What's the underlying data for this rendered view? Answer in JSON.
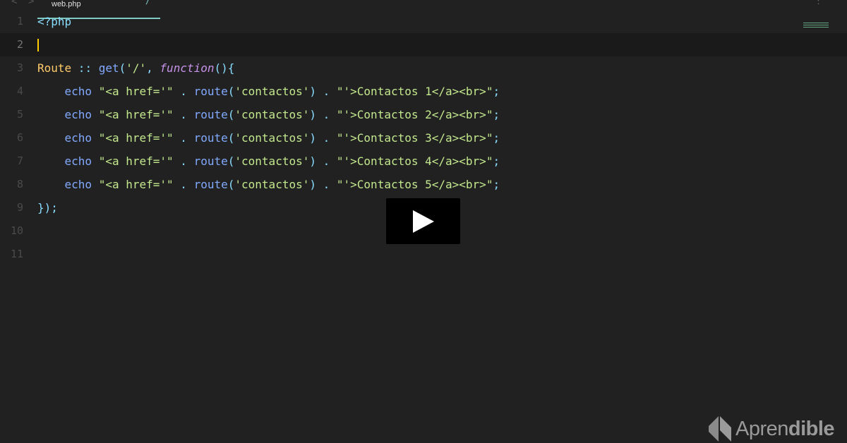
{
  "editor": {
    "tab_label": "web.php",
    "lines": [
      {
        "num": "1",
        "tokens": [
          {
            "t": "<?php",
            "c": "p"
          }
        ]
      },
      {
        "num": "2",
        "tokens": [],
        "active": true
      },
      {
        "num": "3",
        "tokens": [
          {
            "t": "Route",
            "c": "c"
          },
          {
            "t": " :: ",
            "c": "p"
          },
          {
            "t": "get",
            "c": "k"
          },
          {
            "t": "(",
            "c": "p"
          },
          {
            "t": "'/'",
            "c": "s"
          },
          {
            "t": ", ",
            "c": "p"
          },
          {
            "t": "function",
            "c": "f"
          },
          {
            "t": "(){",
            "c": "p"
          }
        ]
      },
      {
        "num": "4",
        "tokens": [
          {
            "t": "    echo ",
            "c": "k"
          },
          {
            "t": "\"<a href='\"",
            "c": "s"
          },
          {
            "t": " . ",
            "c": "p"
          },
          {
            "t": "route",
            "c": "k"
          },
          {
            "t": "(",
            "c": "p"
          },
          {
            "t": "'contactos'",
            "c": "s"
          },
          {
            "t": ") . ",
            "c": "p"
          },
          {
            "t": "\"'>Contactos 1</a><br>\"",
            "c": "s"
          },
          {
            "t": ";",
            "c": "p"
          }
        ]
      },
      {
        "num": "5",
        "tokens": [
          {
            "t": "    echo ",
            "c": "k"
          },
          {
            "t": "\"<a href='\"",
            "c": "s"
          },
          {
            "t": " . ",
            "c": "p"
          },
          {
            "t": "route",
            "c": "k"
          },
          {
            "t": "(",
            "c": "p"
          },
          {
            "t": "'contactos'",
            "c": "s"
          },
          {
            "t": ") . ",
            "c": "p"
          },
          {
            "t": "\"'>Contactos 2</a><br>\"",
            "c": "s"
          },
          {
            "t": ";",
            "c": "p"
          }
        ]
      },
      {
        "num": "6",
        "tokens": [
          {
            "t": "    echo ",
            "c": "k"
          },
          {
            "t": "\"<a href='\"",
            "c": "s"
          },
          {
            "t": " . ",
            "c": "p"
          },
          {
            "t": "route",
            "c": "k"
          },
          {
            "t": "(",
            "c": "p"
          },
          {
            "t": "'contactos'",
            "c": "s"
          },
          {
            "t": ") . ",
            "c": "p"
          },
          {
            "t": "\"'>Contactos 3</a><br>\"",
            "c": "s"
          },
          {
            "t": ";",
            "c": "p"
          }
        ]
      },
      {
        "num": "7",
        "tokens": [
          {
            "t": "    echo ",
            "c": "k"
          },
          {
            "t": "\"<a href='\"",
            "c": "s"
          },
          {
            "t": " . ",
            "c": "p"
          },
          {
            "t": "route",
            "c": "k"
          },
          {
            "t": "(",
            "c": "p"
          },
          {
            "t": "'contactos'",
            "c": "s"
          },
          {
            "t": ") . ",
            "c": "p"
          },
          {
            "t": "\"'>Contactos 4</a><br>\"",
            "c": "s"
          },
          {
            "t": ";",
            "c": "p"
          }
        ]
      },
      {
        "num": "8",
        "tokens": [
          {
            "t": "    echo ",
            "c": "k"
          },
          {
            "t": "\"<a href='\"",
            "c": "s"
          },
          {
            "t": " . ",
            "c": "p"
          },
          {
            "t": "route",
            "c": "k"
          },
          {
            "t": "(",
            "c": "p"
          },
          {
            "t": "'contactos'",
            "c": "s"
          },
          {
            "t": ") . ",
            "c": "p"
          },
          {
            "t": "\"'>Contactos 5</a><br>\"",
            "c": "s"
          },
          {
            "t": ";",
            "c": "p"
          }
        ]
      },
      {
        "num": "9",
        "tokens": [
          {
            "t": "});",
            "c": "p"
          }
        ]
      },
      {
        "num": "10",
        "tokens": []
      },
      {
        "num": "11",
        "tokens": []
      }
    ]
  },
  "video": {
    "play_icon": "play-icon"
  },
  "brand": {
    "logo_light": "Apren",
    "logo_bold": "dible"
  }
}
